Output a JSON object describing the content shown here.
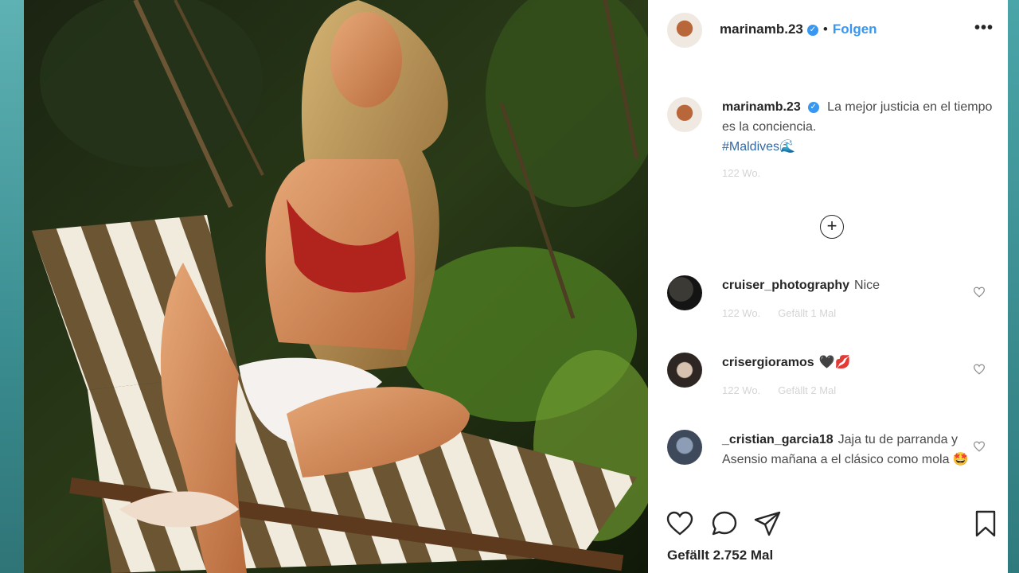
{
  "post": {
    "username": "marinamb.23",
    "follow_label": "Folgen",
    "dot": "•",
    "more_label": "•••",
    "caption_text": "La mejor justicia en el tiempo es la conciencia.",
    "hashtag": "#Maldives",
    "caption_emoji": "🌊",
    "caption_time": "122 Wo.",
    "load_more_label": "+"
  },
  "comments": [
    {
      "username": "cruiser_photography",
      "text": "Nice",
      "time": "122 Wo.",
      "likes": "Gefällt 1 Mal"
    },
    {
      "username": "crisergioramos",
      "text": "🖤💋",
      "time": "122 Wo.",
      "likes": "Gefällt 2 Mal"
    },
    {
      "username": "_cristian_garcia18",
      "text": "Jaja tu de parranda y Asensio mañana a el clásico como mola 🤩"
    }
  ],
  "likes_label": "Gefällt 2.752 Mal",
  "icons": {
    "like": "heart-icon",
    "comment": "comment-icon",
    "share": "paper-plane-icon",
    "save": "bookmark-icon",
    "verified": "verified-badge-icon"
  },
  "colors": {
    "link_blue": "#3897f0",
    "hashtag_blue": "#3069a8",
    "text": "#262626",
    "muted": "#d4d4d4"
  }
}
